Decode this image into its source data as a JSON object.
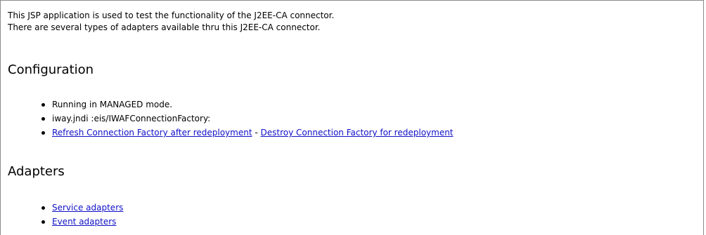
{
  "intro": {
    "line1": "This JSP application is used to test the functionality of the J2EE-CA connector.",
    "line2": "There are several types of adapters available thru this J2EE-CA connector."
  },
  "configuration": {
    "heading": "Configuration",
    "mode_text": "Running in MANAGED mode.",
    "jndi_text": "iway.jndi :eis/IWAFConnectionFactory:",
    "refresh_link": "Refresh Connection Factory after redeployment",
    "separator": " - ",
    "destroy_link": "Destroy Connection Factory for redeployment"
  },
  "adapters": {
    "heading": "Adapters",
    "service_link": "Service adapters",
    "event_link": "Event adapters"
  },
  "colors": {
    "link": "#1010c8",
    "border": "#8a8a8a"
  }
}
